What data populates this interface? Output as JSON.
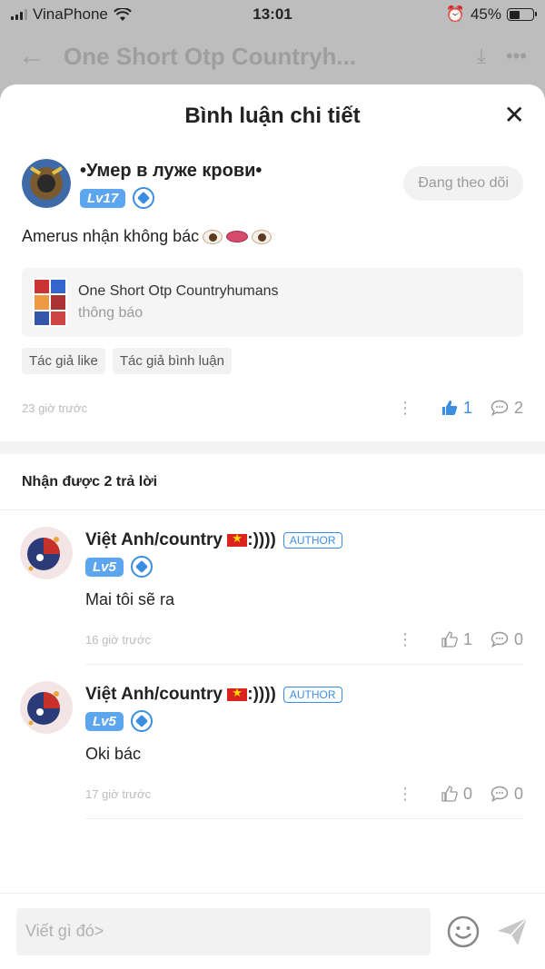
{
  "status_bar": {
    "carrier": "VinaPhone",
    "time": "13:01",
    "battery": "45%",
    "battery_level": 0.45
  },
  "app_bar": {
    "title": "One Short Otp Countryh..."
  },
  "sheet": {
    "title": "Bình luận chi tiết"
  },
  "main_comment": {
    "username": "•Умер в луже крови•",
    "level": "Lv17",
    "follow_label": "Đang theo dõi",
    "text": "Amerus nhận không bác",
    "post": {
      "title": "One Short Otp Countryhumans",
      "subtitle": "thông báo"
    },
    "tags": [
      "Tác giả like",
      "Tác giả bình luận"
    ],
    "time": "23 giờ trước",
    "likes": "1",
    "comments": "2"
  },
  "replies_header": "Nhận được 2 trả lời",
  "replies": [
    {
      "username": "Việt Anh/country",
      "suffix": ":))))",
      "author_label": "AUTHOR",
      "level": "Lv5",
      "text": "Mai tôi sẽ ra",
      "time": "16 giờ trước",
      "likes": "1",
      "comments": "0"
    },
    {
      "username": "Việt Anh/country",
      "suffix": ":))))",
      "author_label": "AUTHOR",
      "level": "Lv5",
      "text": "Oki bác",
      "time": "17 giờ trước",
      "likes": "0",
      "comments": "0"
    }
  ],
  "input": {
    "placeholder": "Viết gì đó>"
  },
  "colors": {
    "accent": "#3b8de0",
    "level_badge": "#5ca6f0",
    "flag_red": "#da251d"
  }
}
